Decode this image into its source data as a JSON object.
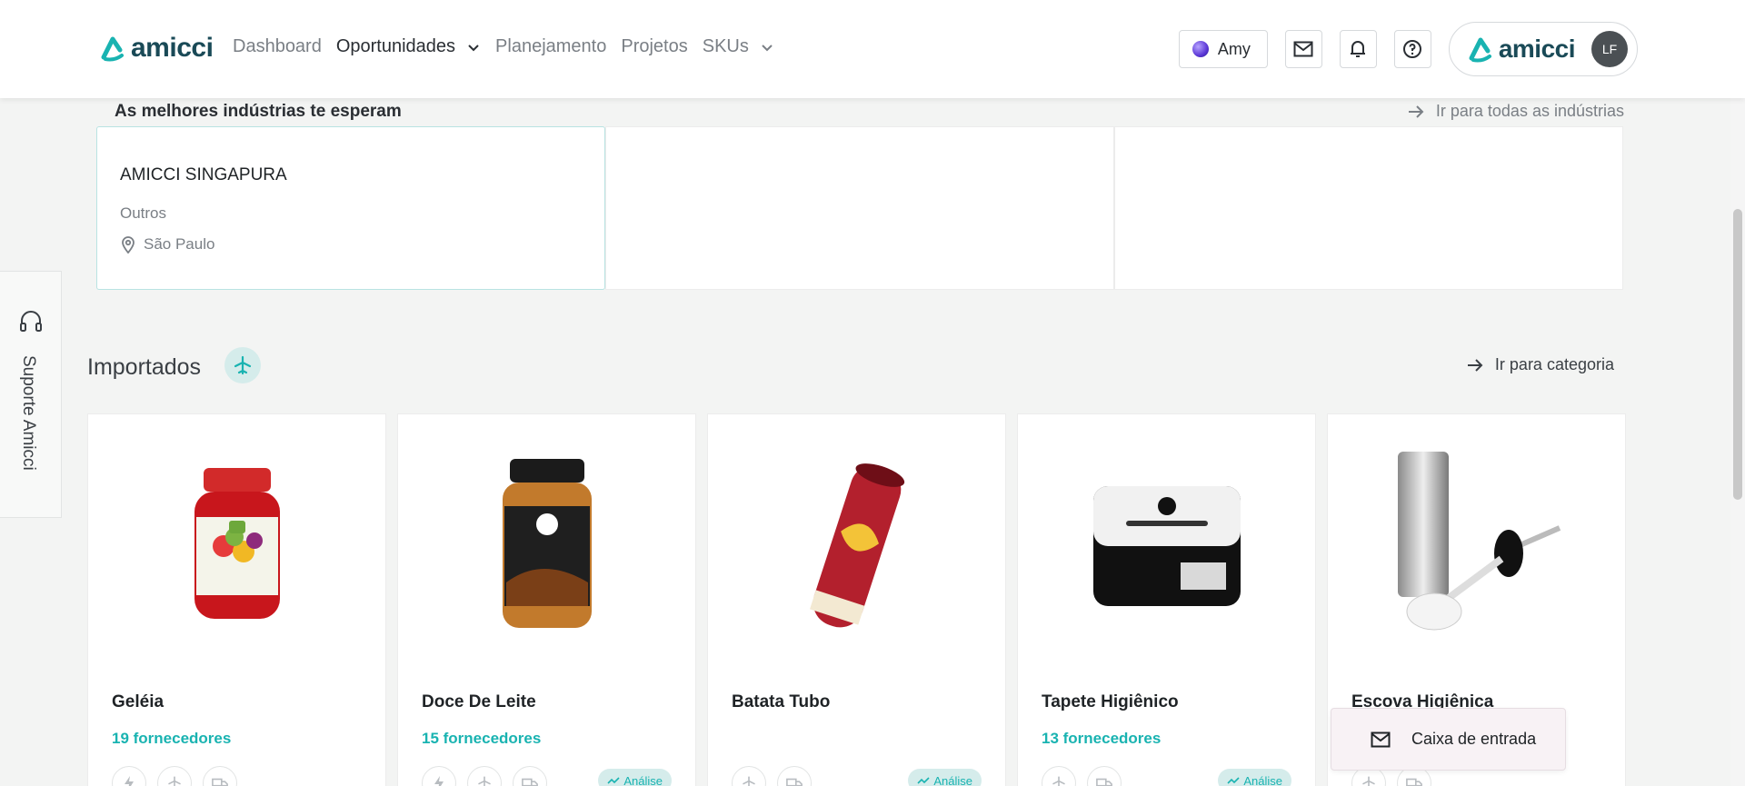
{
  "brand": {
    "name": "amicci",
    "accent": "#19b3b1",
    "dark": "#1a4a57"
  },
  "nav": {
    "dashboard": "Dashboard",
    "oportunidades": "Oportunidades",
    "planejamento": "Planejamento",
    "projetos": "Projetos",
    "skus": "SKUs"
  },
  "header": {
    "assistant_label": "Amy",
    "avatar_initials": "LF"
  },
  "industries": {
    "title": "As melhores indústrias te esperam",
    "link": "Ir para todas as indústrias",
    "cards": [
      {
        "name": "AMICCI SINGAPURA",
        "category": "Outros",
        "location": "São Paulo"
      }
    ]
  },
  "support": {
    "label": "Suporte Amicci"
  },
  "imported": {
    "title": "Importados",
    "link": "Ir para categoria",
    "products": [
      {
        "name": "Geléia",
        "suppliers": "19 fornecedores",
        "tag": ""
      },
      {
        "name": "Doce De Leite",
        "suppliers": "15 fornecedores",
        "tag": "Análise"
      },
      {
        "name": "Batata Tubo",
        "suppliers": "",
        "tag": "Análise"
      },
      {
        "name": "Tapete Higiênico",
        "suppliers": "13 fornecedores",
        "tag": "Análise"
      },
      {
        "name": "Escova Higiênica",
        "suppliers": "",
        "tag": ""
      }
    ]
  },
  "inbox": {
    "label": "Caixa de entrada"
  }
}
